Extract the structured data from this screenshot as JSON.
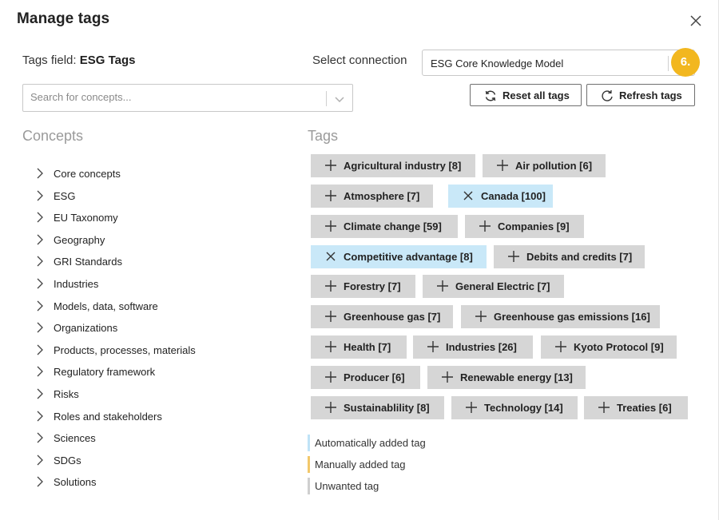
{
  "dialog": {
    "title": "Manage tags"
  },
  "tags_field": {
    "label": "Tags field:",
    "value": "ESG Tags"
  },
  "connection": {
    "label": "Select connection",
    "value": "ESG Core Knowledge Model"
  },
  "step_badge": "6.",
  "search": {
    "placeholder": "Search for concepts..."
  },
  "buttons": {
    "reset": "Reset all tags",
    "refresh": "Refresh tags"
  },
  "concepts": {
    "heading": "Concepts",
    "items": [
      "Core concepts",
      "ESG",
      "EU Taxonomy",
      "Geography",
      "GRI Standards",
      "Industries",
      "Models, data, software",
      "Organizations",
      "Products, processes, materials",
      "Regulatory framework",
      "Risks",
      "Roles and stakeholders",
      "Sciences",
      "SDGs",
      "Solutions"
    ]
  },
  "tags": {
    "heading": "Tags",
    "items": [
      {
        "label": "Agricultural industry [8]",
        "state": "unwanted"
      },
      {
        "label": "Air pollution [6]",
        "state": "unwanted"
      },
      {
        "label": "Atmosphere [7]",
        "state": "unwanted"
      },
      {
        "label": "Canada [100]",
        "state": "automatic"
      },
      {
        "label": "Climate change [59]",
        "state": "unwanted"
      },
      {
        "label": "Companies [9]",
        "state": "unwanted"
      },
      {
        "label": "Competitive advantage [8]",
        "state": "automatic"
      },
      {
        "label": "Debits and credits [7]",
        "state": "unwanted"
      },
      {
        "label": "Forestry [7]",
        "state": "unwanted"
      },
      {
        "label": "General Electric [7]",
        "state": "unwanted"
      },
      {
        "label": "Greenhouse gas [7]",
        "state": "unwanted"
      },
      {
        "label": "Greenhouse gas emissions [16]",
        "state": "unwanted"
      },
      {
        "label": "Health [7]",
        "state": "unwanted"
      },
      {
        "label": "Industries [26]",
        "state": "unwanted"
      },
      {
        "label": "Kyoto Protocol [9]",
        "state": "unwanted"
      },
      {
        "label": "Producer [6]",
        "state": "unwanted"
      },
      {
        "label": "Renewable energy [13]",
        "state": "unwanted"
      },
      {
        "label": "Sustainablility [8]",
        "state": "unwanted"
      },
      {
        "label": "Technology [14]",
        "state": "unwanted"
      },
      {
        "label": "Treaties [6]",
        "state": "unwanted"
      }
    ]
  },
  "legend": {
    "automatic": "Automatically added tag",
    "manual": "Manually added tag",
    "unwanted": "Unwanted tag"
  },
  "colors": {
    "automatic": "#c9e8f8",
    "manual": "#f2c86b",
    "unwanted": "#d6d6d6",
    "automatic_bar": "#bfe3f7",
    "unwanted_bar": "#cfcfcf",
    "badge": "#f2b71f"
  }
}
